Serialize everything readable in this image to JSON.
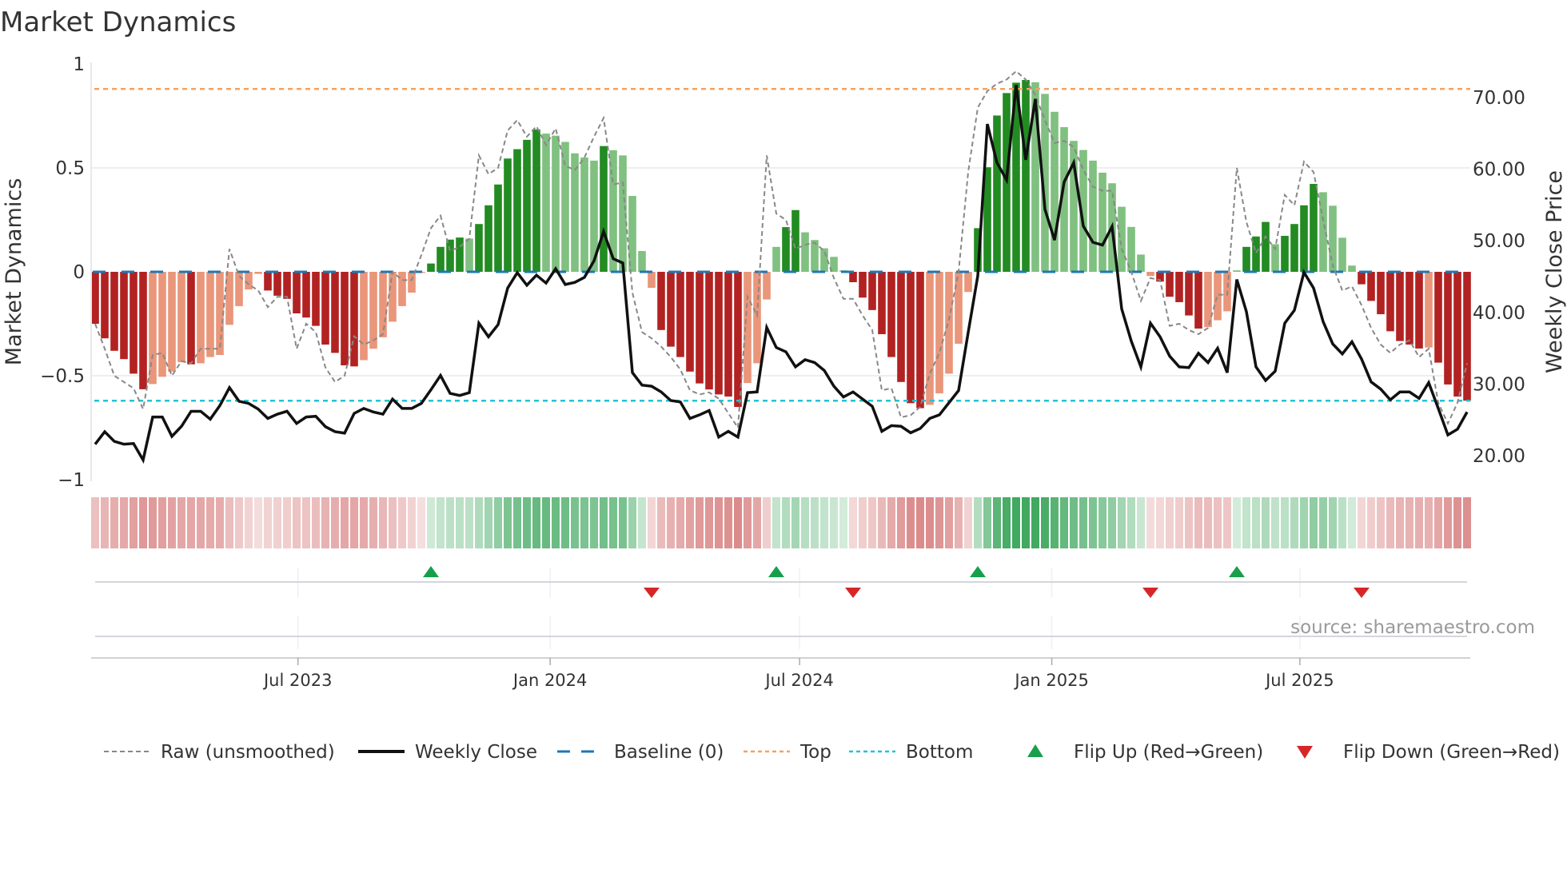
{
  "title": "Market Dynamics",
  "source": "source: sharemaestro.com",
  "colors": {
    "pos_strong": "#228b22",
    "pos_weak": "#80c080",
    "neg_strong": "#b22222",
    "neg_weak": "#e9967a",
    "baseline": "#1f77b4",
    "top": "#f4a261",
    "bottom": "#22c3d6",
    "raw": "#888888",
    "close": "#111111",
    "flip_up": "#17a04b",
    "flip_down": "#d62728",
    "strip_pos": "46,160,80",
    "strip_neg": "205,92,92"
  },
  "legend": [
    {
      "key": "raw",
      "label": "Raw (unsmoothed)"
    },
    {
      "key": "close",
      "label": "Weekly Close"
    },
    {
      "key": "baseline",
      "label": "Baseline (0)"
    },
    {
      "key": "top",
      "label": "Top"
    },
    {
      "key": "bottom",
      "label": "Bottom"
    },
    {
      "key": "flip_up",
      "label": "Flip Up (Red→Green)"
    },
    {
      "key": "flip_down",
      "label": "Flip Down (Green→Red)"
    }
  ],
  "chart_data": {
    "type": "bar",
    "title": "Market Dynamics",
    "ylabel": "Market Dynamics",
    "y2label": "Weekly Close Price",
    "ylim": [
      -1,
      1
    ],
    "y2lim": [
      15.9,
      74.6
    ],
    "yticks": [
      {
        "v": 1,
        "label": "1"
      },
      {
        "v": 0.5,
        "label": "0.5"
      },
      {
        "v": 0,
        "label": "0"
      },
      {
        "v": -0.5,
        "label": "−0.5"
      },
      {
        "v": -1,
        "label": "−1"
      }
    ],
    "y2ticks": [
      {
        "v": 70,
        "label": "70.00"
      },
      {
        "v": 60,
        "label": "60.00"
      },
      {
        "v": 50,
        "label": "50.00"
      },
      {
        "v": 40,
        "label": "40.00"
      },
      {
        "v": 30,
        "label": "30.00"
      },
      {
        "v": 20,
        "label": "20.00"
      }
    ],
    "xticks": [
      {
        "date": "2023-07-01",
        "label": "Jul 2023"
      },
      {
        "date": "2024-01-01",
        "label": "Jan 2024"
      },
      {
        "date": "2024-07-01",
        "label": "Jul 2024"
      },
      {
        "date": "2025-01-01",
        "label": "Jan 2025"
      },
      {
        "date": "2025-07-01",
        "label": "Jul 2025"
      }
    ],
    "start_date": "2023-02-03",
    "interval_days": 7,
    "top_level": 0.88,
    "bottom_level": -0.62,
    "baseline": 0,
    "grid": true,
    "legend_position": "bottom",
    "smoothed": [
      -0.25,
      -0.32,
      -0.38,
      -0.42,
      -0.49,
      -0.565,
      -0.54,
      -0.505,
      -0.48,
      -0.435,
      -0.445,
      -0.44,
      -0.41,
      -0.4,
      -0.255,
      -0.165,
      -0.085,
      -0.01,
      -0.09,
      -0.115,
      -0.13,
      -0.2,
      -0.22,
      -0.26,
      -0.35,
      -0.39,
      -0.45,
      -0.455,
      -0.425,
      -0.37,
      -0.315,
      -0.24,
      -0.165,
      -0.1,
      -0.005,
      0.04,
      0.12,
      0.155,
      0.165,
      0.16,
      0.23,
      0.32,
      0.42,
      0.545,
      0.59,
      0.635,
      0.685,
      0.665,
      0.655,
      0.625,
      0.57,
      0.55,
      0.535,
      0.605,
      0.585,
      0.56,
      0.365,
      0.1,
      -0.077,
      -0.28,
      -0.36,
      -0.41,
      -0.48,
      -0.537,
      -0.566,
      -0.59,
      -0.6,
      -0.65,
      -0.535,
      -0.44,
      -0.133,
      0.12,
      0.215,
      0.297,
      0.19,
      0.153,
      0.113,
      0.072,
      0.007,
      -0.05,
      -0.124,
      -0.184,
      -0.3,
      -0.41,
      -0.53,
      -0.632,
      -0.656,
      -0.64,
      -0.585,
      -0.49,
      -0.346,
      -0.097,
      0.21,
      0.503,
      0.752,
      0.86,
      0.91,
      0.923,
      0.912,
      0.856,
      0.77,
      0.696,
      0.63,
      0.586,
      0.535,
      0.477,
      0.426,
      0.313,
      0.216,
      0.083,
      -0.02,
      -0.047,
      -0.12,
      -0.146,
      -0.21,
      -0.273,
      -0.266,
      -0.233,
      -0.19,
      0.007,
      0.12,
      0.17,
      0.24,
      0.133,
      0.173,
      0.23,
      0.32,
      0.423,
      0.383,
      0.318,
      0.164,
      0.03,
      -0.06,
      -0.14,
      -0.204,
      -0.286,
      -0.333,
      -0.35,
      -0.369,
      -0.364,
      -0.437,
      -0.542,
      -0.6,
      -0.62
    ],
    "raw": [
      -0.25,
      -0.37,
      -0.5,
      -0.53,
      -0.56,
      -0.66,
      -0.4,
      -0.39,
      -0.5,
      -0.43,
      -0.44,
      -0.37,
      -0.37,
      -0.37,
      0.11,
      -0.02,
      -0.06,
      -0.09,
      -0.17,
      -0.12,
      -0.12,
      -0.37,
      -0.25,
      -0.29,
      -0.46,
      -0.53,
      -0.5,
      -0.31,
      -0.35,
      -0.33,
      -0.3,
      0.0,
      -0.04,
      -0.04,
      0.08,
      0.21,
      0.27,
      0.1,
      0.12,
      0.16,
      0.56,
      0.47,
      0.5,
      0.68,
      0.73,
      0.65,
      0.7,
      0.61,
      0.69,
      0.51,
      0.49,
      0.55,
      0.65,
      0.74,
      0.42,
      0.43,
      -0.1,
      -0.29,
      -0.32,
      -0.36,
      -0.41,
      -0.47,
      -0.57,
      -0.59,
      -0.58,
      -0.61,
      -0.68,
      -0.75,
      -0.12,
      -0.21,
      0.56,
      0.28,
      0.25,
      0.11,
      0.13,
      0.14,
      0.1,
      -0.03,
      -0.13,
      -0.13,
      -0.21,
      -0.28,
      -0.57,
      -0.56,
      -0.7,
      -0.69,
      -0.65,
      -0.49,
      -0.39,
      -0.23,
      0.0,
      0.48,
      0.79,
      0.87,
      0.905,
      0.925,
      0.965,
      0.925,
      0.85,
      0.73,
      0.62,
      0.63,
      0.6,
      0.49,
      0.41,
      0.39,
      0.39,
      0.11,
      0.0,
      -0.14,
      -0.03,
      -0.04,
      -0.26,
      -0.25,
      -0.28,
      -0.3,
      -0.27,
      -0.11,
      -0.11,
      0.5,
      0.24,
      0.09,
      0.17,
      0.11,
      0.37,
      0.32,
      0.53,
      0.48,
      0.25,
      0.03,
      -0.09,
      -0.07,
      -0.16,
      -0.27,
      -0.35,
      -0.39,
      -0.35,
      -0.33,
      -0.41,
      -0.37,
      -0.63,
      -0.73,
      -0.63,
      -0.44
    ],
    "close": [
      21.6,
      23.35,
      22.0,
      21.6,
      21.7,
      19.4,
      25.4,
      25.4,
      22.7,
      24.1,
      26.2,
      26.2,
      25.1,
      27.0,
      29.5,
      27.6,
      27.3,
      26.5,
      25.2,
      25.8,
      26.2,
      24.5,
      25.4,
      25.5,
      24.05,
      23.35,
      23.15,
      25.9,
      26.6,
      26.1,
      25.8,
      27.9,
      26.6,
      26.6,
      27.3,
      29.2,
      31.2,
      28.7,
      28.4,
      28.8,
      38.5,
      36.6,
      38.3,
      43.4,
      45.55,
      43.8,
      45.2,
      44.1,
      46.1,
      43.9,
      44.2,
      44.9,
      47.2,
      51.3,
      47.5,
      46.9,
      31.6,
      29.85,
      29.7,
      28.9,
      27.7,
      27.5,
      25.2,
      25.7,
      26.3,
      22.6,
      23.4,
      22.6,
      28.8,
      28.9,
      37.9,
      35.1,
      34.5,
      32.4,
      33.4,
      33.0,
      31.9,
      29.7,
      28.2,
      28.9,
      27.9,
      26.9,
      23.4,
      24.2,
      24.1,
      23.2,
      23.8,
      25.2,
      25.7,
      27.4,
      29.1,
      37.2,
      45.1,
      66.3,
      60.9,
      58.5,
      71.75,
      61.3,
      69.8,
      54.4,
      50.1,
      58.2,
      60.9,
      52.05,
      49.8,
      49.4,
      52.0,
      40.5,
      36.0,
      32.4,
      38.5,
      36.6,
      33.9,
      32.4,
      32.3,
      34.3,
      33.0,
      35.0,
      31.6,
      44.6,
      40.1,
      32.4,
      30.5,
      31.8,
      38.5,
      40.3,
      45.6,
      43.4,
      38.7,
      35.6,
      34.2,
      35.9,
      33.5,
      30.3,
      29.3,
      27.8,
      28.9,
      28.9,
      28.0,
      30.2,
      26.6,
      22.9,
      23.7,
      26.1
    ]
  }
}
